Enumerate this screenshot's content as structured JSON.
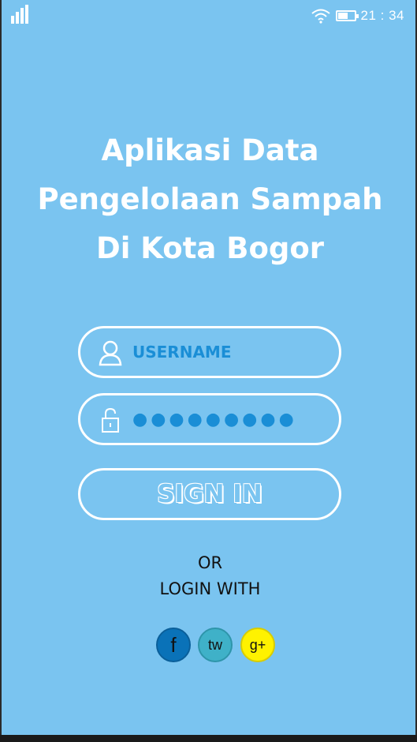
{
  "status_bar": {
    "time": "21 : 34",
    "signal_icon": "signal-bars-icon",
    "wifi_icon": "wifi-icon",
    "battery_icon": "battery-icon"
  },
  "title": {
    "line1": "Aplikasi Data",
    "line2": "Pengelolaan Sampah",
    "line3": "Di Kota Bogor"
  },
  "login": {
    "username_placeholder": "USERNAME",
    "password_value": "●●●●●●●●●",
    "user_icon": "user-icon",
    "lock_icon": "lock-icon",
    "signin_label": "SIGN IN"
  },
  "alt_login": {
    "or_label": "OR",
    "login_with_label": "LOGIN WITH",
    "facebook_label": "f",
    "twitter_label": "tw",
    "google_label": "g+"
  },
  "colors": {
    "background": "#7ac4f0",
    "accent_text": "#1a8ed6",
    "facebook": "#0a72b8",
    "twitter": "#3fb1c8",
    "google": "#fff200"
  }
}
